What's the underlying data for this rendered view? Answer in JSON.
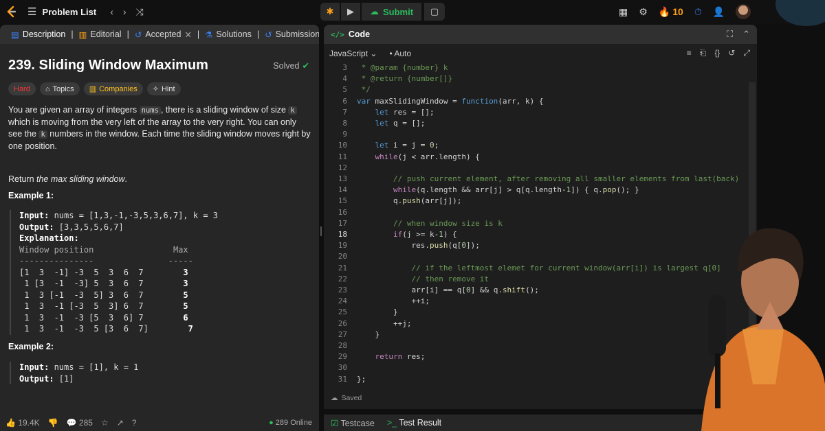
{
  "topbar": {
    "problem_list": "Problem List",
    "submit": "Submit",
    "streak": "10"
  },
  "left_tabs": [
    {
      "label": "Description"
    },
    {
      "label": "Editorial"
    },
    {
      "label": "Accepted"
    },
    {
      "label": "Solutions"
    },
    {
      "label": "Submissions"
    }
  ],
  "problem": {
    "title": "239. Sliding Window Maximum",
    "status": "Solved",
    "tags": [
      "Hard",
      "Topics",
      "Companies",
      "Hint"
    ],
    "desc_1": "You are given an array of integers ",
    "desc_nums": "nums",
    "desc_2": ", there is a sliding window of size ",
    "desc_k": "k",
    "desc_3": " which is moving from the very left of the array to the very right. You can only see the ",
    "desc_k2": "k",
    "desc_4": " numbers in the window. Each time the sliding window moves right by one position.",
    "return_prefix": "Return ",
    "return_em": "the max sliding window",
    "return_suffix": "."
  },
  "example1": {
    "title": "Example 1:",
    "input_label": "Input:",
    "input_value": " nums = [1,3,-1,-3,5,3,6,7], k = 3",
    "output_label": "Output:",
    "output_value": " [3,3,5,5,6,7]",
    "explanation_label": "Explanation:",
    "table_header": "Window position                Max",
    "table_rule": "---------------               -----",
    "rows": [
      {
        "pos": "[1  3  -1] -3  5  3  6  7",
        "max": "3"
      },
      {
        "pos": " 1 [3  -1  -3] 5  3  6  7",
        "max": "3"
      },
      {
        "pos": " 1  3 [-1  -3  5] 3  6  7",
        "max": "5"
      },
      {
        "pos": " 1  3  -1 [-3  5  3] 6  7",
        "max": "5"
      },
      {
        "pos": " 1  3  -1  -3 [5  3  6] 7",
        "max": "6"
      },
      {
        "pos": " 1  3  -1  -3  5 [3  6  7]",
        "max": "7"
      }
    ]
  },
  "example2": {
    "title": "Example 2:",
    "input_label": "Input:",
    "input_value": " nums = [1], k = 1",
    "output_label": "Output:",
    "output_value": " [1]"
  },
  "left_footer": {
    "likes": "19.4K",
    "comments": "285",
    "online": "289 Online"
  },
  "code_panel": {
    "title": "Code",
    "language": "JavaScript",
    "mode": "Auto",
    "saved": "Saved",
    "current_line": 18
  },
  "code_lines": [
    {
      "n": "3",
      "text": " * @param {number} k"
    },
    {
      "n": "4",
      "text": " * @return {number[]}"
    },
    {
      "n": "5",
      "text": " */"
    },
    {
      "n": "6",
      "text": "var maxSlidingWindow = function(arr, k) {"
    },
    {
      "n": "7",
      "text": "    let res = [];"
    },
    {
      "n": "8",
      "text": "    let q = [];"
    },
    {
      "n": "9",
      "text": ""
    },
    {
      "n": "10",
      "text": "    let i = j = 0;"
    },
    {
      "n": "11",
      "text": "    while(j < arr.length) {"
    },
    {
      "n": "12",
      "text": ""
    },
    {
      "n": "13",
      "text": "        // push current element, after removing all smaller elements from last(back)"
    },
    {
      "n": "14",
      "text": "        while(q.length && arr[j] > q[q.length-1]) { q.pop(); }"
    },
    {
      "n": "15",
      "text": "        q.push(arr[j]);"
    },
    {
      "n": "16",
      "text": ""
    },
    {
      "n": "17",
      "text": "        // when window size is k"
    },
    {
      "n": "18",
      "text": "        if(j >= k-1) {"
    },
    {
      "n": "19",
      "text": "            res.push(q[0]);"
    },
    {
      "n": "20",
      "text": ""
    },
    {
      "n": "21",
      "text": "            // if the leftmost elemet for current window(arr[i]) is largest q[0]"
    },
    {
      "n": "22",
      "text": "            // then remove it"
    },
    {
      "n": "23",
      "text": "            arr[i] == q[0] && q.shift();"
    },
    {
      "n": "24",
      "text": "            ++i;"
    },
    {
      "n": "25",
      "text": "        }"
    },
    {
      "n": "26",
      "text": "        ++j;"
    },
    {
      "n": "27",
      "text": "    }"
    },
    {
      "n": "28",
      "text": ""
    },
    {
      "n": "29",
      "text": "    return res;"
    },
    {
      "n": "30",
      "text": ""
    },
    {
      "n": "31",
      "text": "};"
    }
  ],
  "bottom_tabs": [
    "Testcase",
    "Test Result"
  ],
  "colors": {
    "accent_green": "#2cbb5d",
    "hard_red": "#f63737",
    "streak_orange": "#ffa116",
    "companies_yellow": "#ffc01e"
  }
}
